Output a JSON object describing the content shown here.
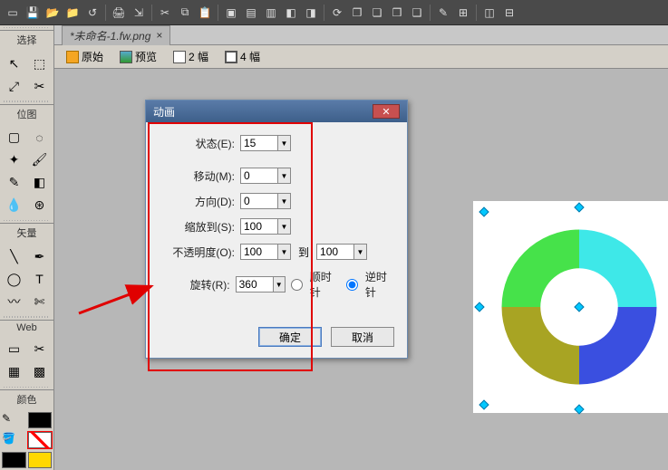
{
  "top_toolbar": {
    "items": [
      "new",
      "save",
      "open",
      "open2",
      "history",
      "print",
      "import",
      "cut",
      "copy",
      "paste",
      "group",
      "front",
      "back",
      "align-l",
      "align-r",
      "rotate",
      "layers",
      "stack",
      "zstack",
      "bring-fwd",
      "path",
      "merge"
    ]
  },
  "left_panel": {
    "sections": {
      "select": "选择",
      "bitmap": "位图",
      "vector": "矢量",
      "web": "Web",
      "color": "颜色"
    }
  },
  "tab": {
    "title": "*未命名-1.fw.png"
  },
  "view_bar": {
    "original": "原始",
    "preview": "预览",
    "two_up": "2 幅",
    "four_up": "4 幅"
  },
  "dialog": {
    "title": "动画",
    "labels": {
      "states": "状态(E):",
      "move": "移动(M):",
      "direction": "方向(D):",
      "scale": "缩放到(S):",
      "opacity": "不透明度(O):",
      "to": "到",
      "rotate": "旋转(R):",
      "cw": "顺时针",
      "ccw": "逆时针"
    },
    "values": {
      "states": "15",
      "move": "0",
      "direction": "0",
      "scale": "100",
      "opacity_from": "100",
      "opacity_to": "100",
      "rotate": "360"
    },
    "rotation_dir": "ccw",
    "ok": "确定",
    "cancel": "取消"
  },
  "chart_data": {
    "type": "pie",
    "title": "",
    "slices": [
      {
        "label": "",
        "value": 25,
        "color": "#46e24a"
      },
      {
        "label": "",
        "value": 25,
        "color": "#3ee8e8"
      },
      {
        "label": "",
        "value": 25,
        "color": "#3a4fe0"
      },
      {
        "label": "",
        "value": 25,
        "color": "#a8a423"
      }
    ],
    "inner_radius_ratio": 0.5
  }
}
